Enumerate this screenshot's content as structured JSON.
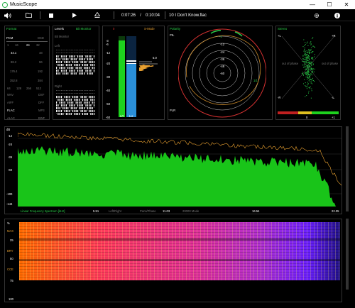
{
  "window": {
    "title": "MusicScope"
  },
  "toolbar": {
    "time_current": "0:07:26",
    "time_sep": "/",
    "time_total": "0:10:04",
    "track": "10 I Don't Know.flac"
  },
  "format": {
    "title": "Format",
    "pcm": "PCM",
    "dsd": "DSD",
    "bits": [
      "1",
      "16",
      "24",
      "32"
    ],
    "rates_left": [
      "44.1",
      "88.2",
      "176.4",
      "352.8"
    ],
    "rates_right": [
      "48",
      "96",
      "192",
      "384"
    ],
    "rates_dsd": [
      "64",
      "128",
      "256",
      "512"
    ],
    "codecs_left": [
      "WAV",
      "AIFF",
      "FLAC",
      "ALAC"
    ],
    "codecs_right": [
      "DSF",
      "DFF",
      "MP3",
      "BWF"
    ]
  },
  "levels": {
    "title": "Levels",
    "mode": "Bit Monitor",
    "sub": "Bit Monitor",
    "left": "Left",
    "right": "Right"
  },
  "meter": {
    "markers": [
      "0",
      "-3",
      "-6",
      "-12",
      "-20",
      "-30",
      "-40",
      "-50",
      "-60"
    ],
    "lr": "LR",
    "lu": "LU",
    "smode": "S-Mode",
    "peak": "5.0",
    "level_left_db": -3,
    "level_right_db": -20
  },
  "polarity": {
    "title": "Polarity",
    "pil": "PIL",
    "plr": "PLR",
    "rings": [
      "-12",
      "-24",
      "-36",
      "-48",
      "-60"
    ],
    "mark_a": "-1",
    "mark_b": "1/1"
  },
  "stereo": {
    "title": "Stereo",
    "plus_l": "+L",
    "plus_r": "+R",
    "minus_l": "-R",
    "minus_r": "-L",
    "out_of_phase_l": "out of phase",
    "out_of_phase_r": "out of phase",
    "zero": "0",
    "plus_one": "+1"
  },
  "spectrum": {
    "db": "dB",
    "yticks": [
      "-12",
      "-24",
      "-36",
      "-60",
      "-100",
      "-144"
    ],
    "caption": "Linear Frequency Spectrum [kHz]",
    "modes": [
      "Left/Right",
      "Pans/Phase",
      "20000 Mode"
    ],
    "xticks": [
      "5.51",
      "11.03",
      "16.54",
      "22.05"
    ]
  },
  "spectrogram": {
    "pct": "%",
    "labels": [
      "MAX",
      "BRY",
      "CCE"
    ],
    "yticks": [
      "25",
      "50",
      "75",
      "100"
    ]
  },
  "colors": {
    "green": "#19c419",
    "orange": "#e8a030",
    "red": "#e03030",
    "blue": "#2a8fd8"
  }
}
